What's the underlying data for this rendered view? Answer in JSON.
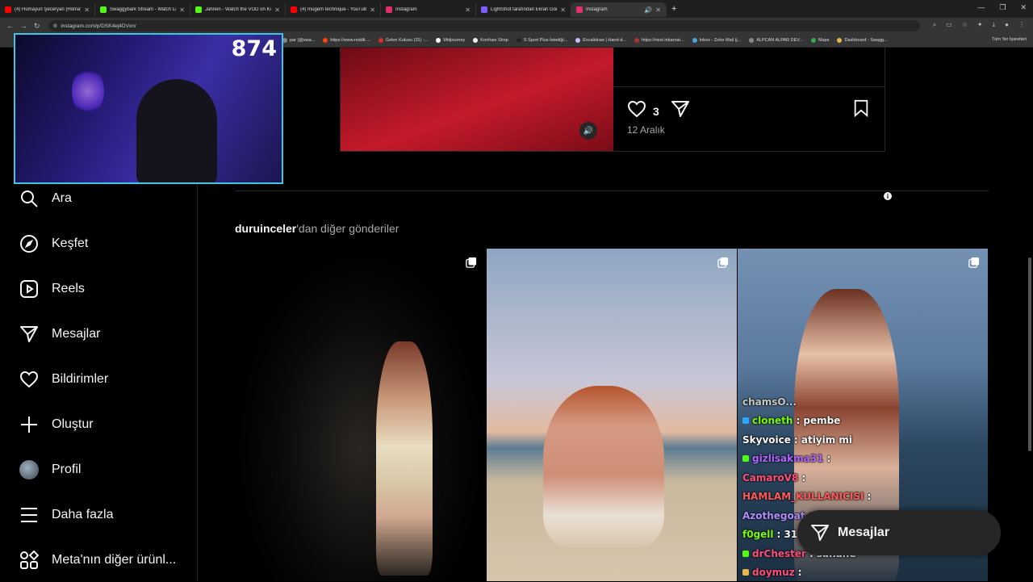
{
  "browser": {
    "tabs": [
      {
        "title": "(4) Hümayun Şeceryan (Homay...",
        "color": "#ff0000",
        "active": false
      },
      {
        "title": "Swaggybark Stream - Watch Li...",
        "color": "#53fc18",
        "active": false
      },
      {
        "title": "Jahrein - Watch the VOD on Ki...",
        "color": "#53fc18",
        "active": false
      },
      {
        "title": "(4) mugem technique - YouTub...",
        "color": "#ff0000",
        "active": false
      },
      {
        "title": "Instagram",
        "color": "#e1306c",
        "active": false
      },
      {
        "title": "LightShot tarafından Ekran Gör...",
        "color": "#7a5cff",
        "active": false
      },
      {
        "title": "Instagram",
        "color": "#e1306c",
        "active": true
      }
    ],
    "url": "instagram.com/p/DSK4ej4DVxn/",
    "bookmarks": [
      "par (@swa...",
      "https://www.reddit....",
      "Gelen Kutusu (31) -...",
      "Midjourney",
      "Konfuse Shop",
      "S Sport Plus-İstediği...",
      "Excalidraw | Hand-d...",
      "https://next.inkarnat...",
      "Inbox - Zoho Mail (j...",
      "ALPCAN ALPAR DEV...",
      "Maps",
      "Dashboard - Swagg..."
    ],
    "bookmarks_right": "Tüm Yer İşaretleri"
  },
  "webcam": {
    "counter": "874"
  },
  "sidebar": {
    "items": [
      {
        "label": "Ara",
        "icon": "search-icon"
      },
      {
        "label": "Keşfet",
        "icon": "compass-icon"
      },
      {
        "label": "Reels",
        "icon": "reels-icon"
      },
      {
        "label": "Mesajlar",
        "icon": "send-icon"
      },
      {
        "label": "Bildirimler",
        "icon": "heart-icon"
      },
      {
        "label": "Oluştur",
        "icon": "plus-icon"
      },
      {
        "label": "Profil",
        "icon": "avatar"
      },
      {
        "label": "Daha fazla",
        "icon": "menu-icon"
      },
      {
        "label": "Meta'nın diğer ürünl...",
        "icon": "apps-icon"
      }
    ]
  },
  "post": {
    "likes": "3",
    "date": "12 Aralık"
  },
  "more_posts": {
    "username": "duruinceler",
    "suffix": "'dan diğer gönderiler"
  },
  "chat": [
    {
      "user": "chamsO...",
      "msg": "",
      "color": "#c9c9c9"
    },
    {
      "user": "cloneth",
      "msg": ": pembe",
      "color": "#7cfc00"
    },
    {
      "user": "Skyvoice",
      "msg": ": atiyim mi",
      "color": "#ffffff"
    },
    {
      "user": "gizlisakma31",
      "msg": ":",
      "color": "#b066ff"
    },
    {
      "user": "CamaroV8",
      "msg": ":",
      "color": "#ff4f7a"
    },
    {
      "user": "HAMLAM_KULLANICISI",
      "msg": ":",
      "color": "#ff5a5a"
    },
    {
      "user": "Azothegoat",
      "msg": ":",
      "color": "#b28cff"
    },
    {
      "user": "f0gell",
      "msg": ": 31",
      "color": "#7cfc00"
    },
    {
      "user": "drChester",
      "msg": ": sanane",
      "color": "#ff4f7a"
    },
    {
      "user": "doymuz",
      "msg": ":",
      "color": "#ff4f7a"
    }
  ],
  "messages_pill": {
    "label": "Mesajlar"
  }
}
